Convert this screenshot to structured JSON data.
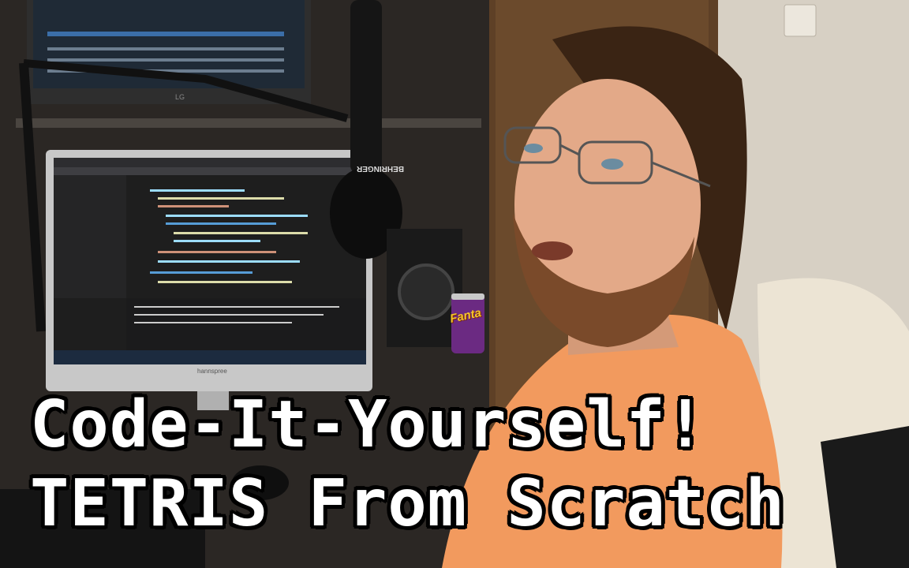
{
  "thumbnail": {
    "title_line_1": "Code-It-Yourself!",
    "title_line_2": "TETRIS From Scratch"
  },
  "props": {
    "can_label": "Fanta",
    "monitor_brand": "hannspree",
    "top_monitor_brand": "LG",
    "mic_brand": "BEHRINGER"
  },
  "colors": {
    "shirt": "#f29a5e",
    "title_text": "#ffffff",
    "title_outline": "#000000",
    "ide_background": "#1e1e1e",
    "chair": "#ece4d4"
  }
}
